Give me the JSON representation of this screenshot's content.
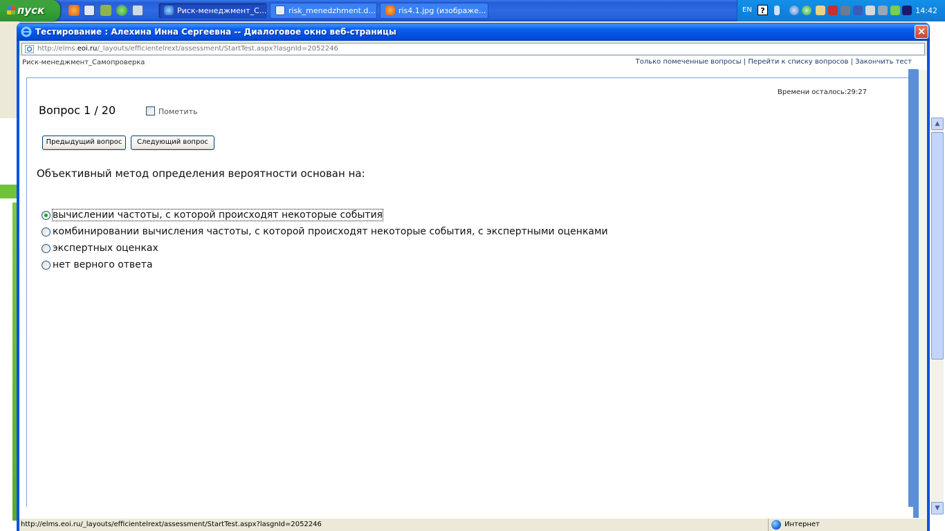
{
  "taskbar": {
    "start_label": "пуск",
    "tasks": [
      {
        "label": "Риск-менеджмент_С...",
        "active": true
      },
      {
        "label": "risk_menedzhment.d...",
        "active": false
      },
      {
        "label": "ris4.1.jpg (изображе...",
        "active": false
      }
    ],
    "tray": {
      "lang": "EN",
      "help": "?",
      "clock": "14:42"
    }
  },
  "dialog": {
    "title": "Тестирование : Алехина Инна Сергеевна -- Диалоговое окно веб-страницы",
    "close": "×",
    "address": {
      "prefix": "http://elms.",
      "host": "eoi.ru",
      "path": "/_layouts/efficientelrext/assessment/StartTest.aspx?lasgnId=2052246"
    }
  },
  "page": {
    "course": "Риск-менеджмент_Самопроверка",
    "links": {
      "marked": "Только помеченные вопросы",
      "sep": " | ",
      "list": "Перейти к списку вопросов",
      "finish": "Закончить тест"
    },
    "timer": "Времени осталось:29:27",
    "question_number": "Вопрос 1 / 20",
    "mark_label": "Пометить",
    "prev_button": "Предыдущий вопрос",
    "next_button": "Следующий вопрос",
    "question_text": "Объективный метод определения вероятности основан на:",
    "options": [
      {
        "label": "вычислении частоты, с которой происходят некоторые события",
        "selected": true
      },
      {
        "label": "комбинировании вычисления частоты, с которой происходят некоторые события, с экспертными оценками",
        "selected": false
      },
      {
        "label": "экспертных оценках",
        "selected": false
      },
      {
        "label": "нет верного ответа",
        "selected": false
      }
    ]
  },
  "status": {
    "url": "http://elms.eoi.ru/_layouts/efficientelrext/assessment/StartTest.aspx?lasgnId=2052246",
    "zone": "Интернет"
  }
}
